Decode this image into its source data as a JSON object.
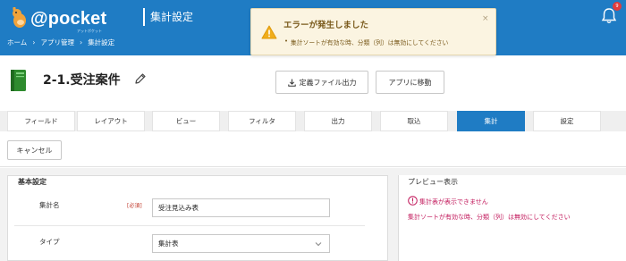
{
  "header": {
    "logo_text": "@pocket",
    "logo_sub": "アットポケット",
    "title": "集計設定",
    "notification_count": "9",
    "breadcrumb": [
      "ホーム",
      "アプリ管理",
      "集計設定"
    ]
  },
  "toast": {
    "title": "エラーが発生しました",
    "message": "集計ソートが有効な時、分類（列）は無効にしてください",
    "close": "×"
  },
  "page": {
    "title": "2-1.受注案件",
    "export_button": "定義ファイル出力",
    "move_button": "アプリに移動"
  },
  "tabs": [
    {
      "label": "フィールド"
    },
    {
      "label": "レイアウト"
    },
    {
      "label": "ビュー"
    },
    {
      "label": "フィルタ"
    },
    {
      "label": "出力"
    },
    {
      "label": "取込"
    },
    {
      "label": "集計",
      "active": true
    },
    {
      "label": "設定"
    }
  ],
  "cancel_label": "キャンセル",
  "basic": {
    "title": "基本設定",
    "name_label": "集計名",
    "required": "[必須]",
    "name_value": "受注見込み表",
    "type_label": "タイプ",
    "type_value": "集計表"
  },
  "preview": {
    "title": "プレビュー表示",
    "error1": "集計表が表示できません",
    "error2": "集計ソートが有効な時、分類（列）は無効にしてください"
  },
  "colors": {
    "header_bg": "#1f7cc4",
    "toast_bg": "#fbf4e1",
    "error_text": "#c2185b",
    "warning_icon": "#f0ad1b"
  }
}
